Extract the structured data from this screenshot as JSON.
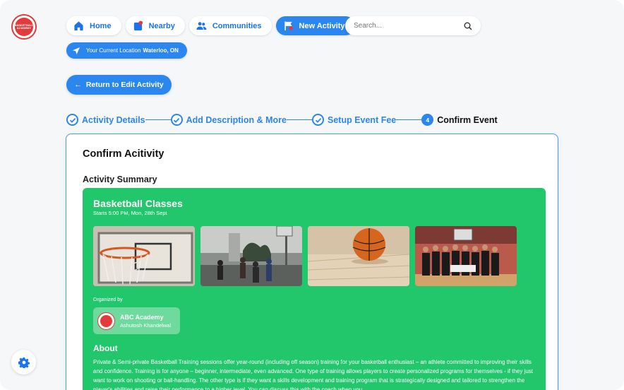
{
  "logo": {
    "text": "BASKETBALL ACADEMY"
  },
  "nav": {
    "items": [
      {
        "label": "Home",
        "icon": "home-icon"
      },
      {
        "label": "Nearby",
        "icon": "map-pin-icon"
      },
      {
        "label": "Communities",
        "icon": "users-icon"
      },
      {
        "label": "New Activity",
        "icon": "flag-icon",
        "active": true
      }
    ]
  },
  "search": {
    "placeholder": "Search..."
  },
  "location": {
    "prefix": "Your Current Location",
    "value": "Waterloo, ON"
  },
  "return_button": {
    "label": "Return to Edit Activity"
  },
  "stepper": {
    "steps": [
      {
        "label": "Activity Details",
        "state": "done"
      },
      {
        "label": "Add Description & More",
        "state": "done"
      },
      {
        "label": "Setup Event Fee",
        "state": "done"
      },
      {
        "label": "Confirm Event",
        "state": "current",
        "number": "4"
      }
    ]
  },
  "card": {
    "title": "Confirm Acitivity",
    "summary_heading": "Activity Summary",
    "activity": {
      "name": "Basketball Classes",
      "starts": "Starts 5:00 PM, Mon, 28th Sept",
      "organized_by_label": "Organized by",
      "organizer_name": "ABC Academy",
      "organizer_person": "Ashutosh Khandelwal",
      "about_heading": "About",
      "about_text": "Private & Semi-private Basketball Training sessions offer year-round (including off season) training for your basketball enthusiast – an athlete committed to improving their skills and confidence. Training is for anyone – beginner, intermediate, even advanced. One type of training allows players to create personalized programs for themselves - if they just want to work on shooting or ball-handling. The other type is if they want a skills development and training program that is strategically designed and tailored to strengthen the player's abilities and raise their performance to a higher level. You can discuss this with the coach when you"
    }
  },
  "colors": {
    "primary": "#2b86f0",
    "summary_bg": "#22c66b",
    "logo_red": "#e23b3b"
  }
}
